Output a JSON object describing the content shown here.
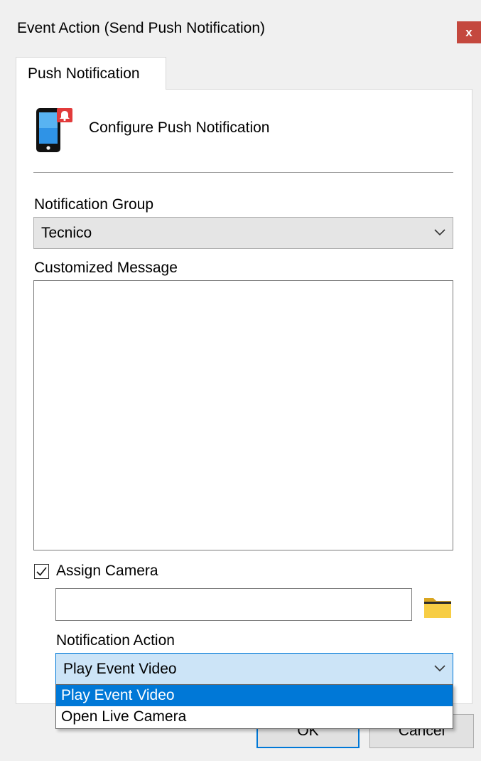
{
  "window": {
    "title": "Event Action (Send Push Notification)",
    "close_label": "x"
  },
  "tabs": [
    {
      "label": "Push Notification"
    }
  ],
  "header": {
    "icon": "phone-notification-icon",
    "title": "Configure Push Notification"
  },
  "notification_group": {
    "label": "Notification Group",
    "value": "Tecnico"
  },
  "customized_message": {
    "label": "Customized Message",
    "value": ""
  },
  "assign_camera": {
    "label": "Assign Camera",
    "checked": true,
    "camera_value": "",
    "browse_icon": "folder-icon"
  },
  "notification_action": {
    "label": "Notification Action",
    "value": "Play Event Video",
    "options": [
      "Play Event Video",
      "Open Live Camera"
    ],
    "selected_index": 0
  },
  "buttons": {
    "ok_label": "OK",
    "cancel_label": "Cancel"
  },
  "colors": {
    "close_button": "#c4483e",
    "accent": "#0078d7",
    "combo_active_bg": "#cce4f7"
  }
}
